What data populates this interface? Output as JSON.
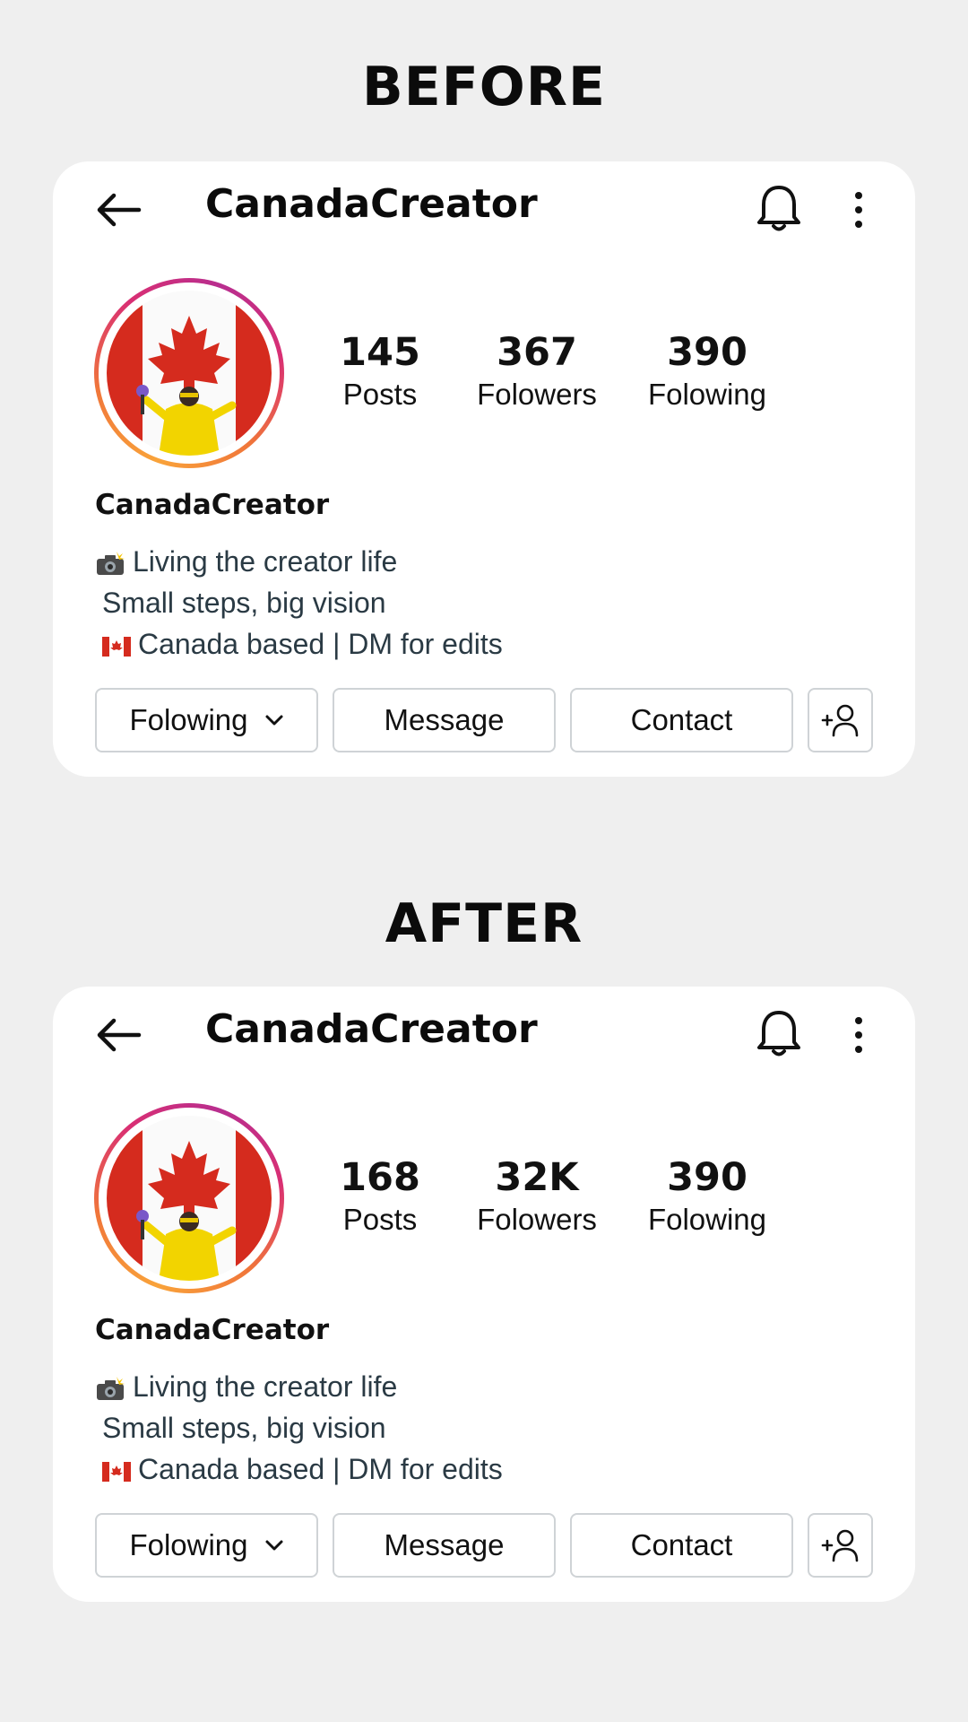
{
  "sections": [
    {
      "heading": "BEFORE",
      "profile": {
        "handle": "CanadaCreator",
        "stats": [
          {
            "value": "145",
            "label": "Posts"
          },
          {
            "value": "367",
            "label": "Folowers"
          },
          {
            "value": "390",
            "label": "Folowing"
          }
        ],
        "display_name": "CanadaCreator",
        "bio": [
          "Living the creator life",
          "Small steps, big vision",
          "Canada based | DM for edits"
        ],
        "buttons": {
          "following": "Folowing",
          "message": "Message",
          "contact": "Contact"
        }
      }
    },
    {
      "heading": "AFTER",
      "profile": {
        "handle": "CanadaCreator",
        "stats": [
          {
            "value": "168",
            "label": "Posts"
          },
          {
            "value": "32K",
            "label": "Folowers"
          },
          {
            "value": "390",
            "label": "Folowing"
          }
        ],
        "display_name": "CanadaCreator",
        "bio": [
          "Living the creator life",
          "Small steps, big vision",
          "Canada based | DM for edits"
        ],
        "buttons": {
          "following": "Folowing",
          "message": "Message",
          "contact": "Contact"
        }
      }
    }
  ],
  "icons": {
    "back": "arrow-left-icon",
    "notifications": "bell-icon",
    "more": "more-vertical-icon",
    "bio_line_1": "camera-flash-icon",
    "bio_line_3": "canada-flag-icon",
    "following_dropdown": "chevron-down-icon",
    "add_user": "add-user-icon",
    "avatar": "canada-flag-avatar"
  },
  "colors": {
    "background": "#efefef",
    "card": "#ffffff",
    "flag_red": "#d52b1e",
    "bio_text": "#2a3a44",
    "button_border": "#cfd3d6",
    "avatar_ring": [
      "#f9a33a",
      "#d92f73"
    ]
  }
}
